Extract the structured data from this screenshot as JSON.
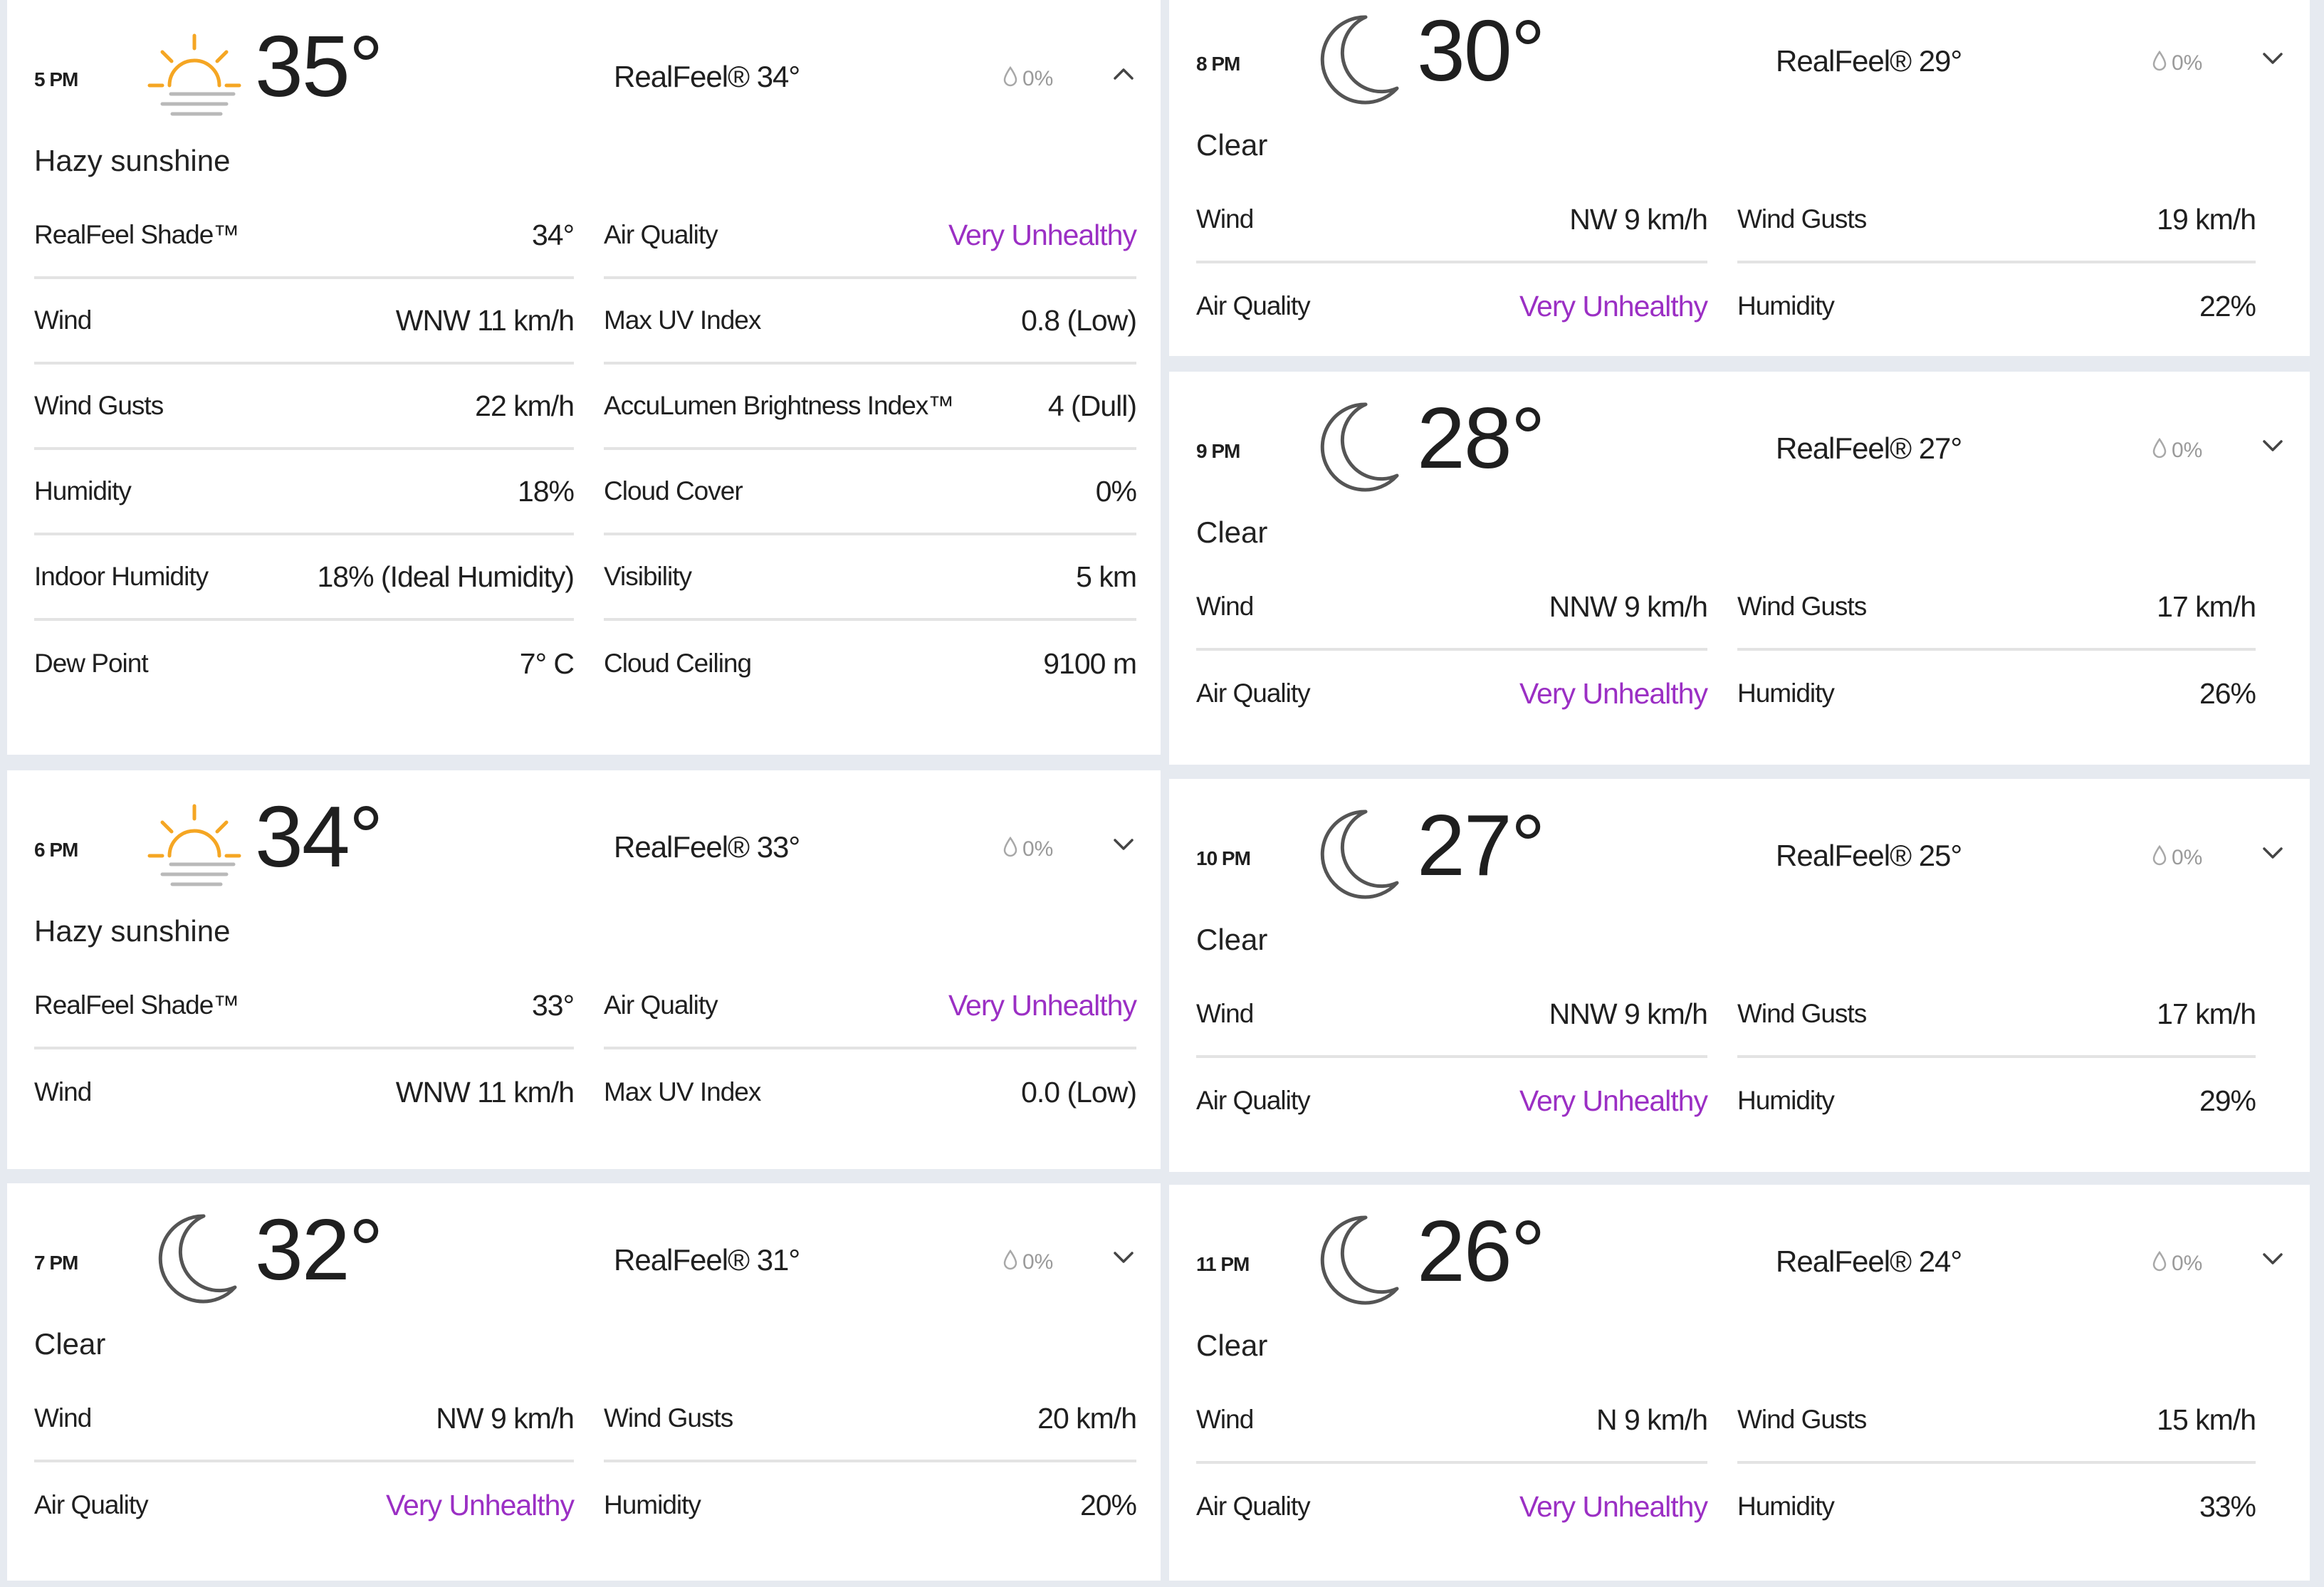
{
  "colors": {
    "air_quality": "#9b2fc4",
    "sun": "#f5a623",
    "text": "#1f1f1f",
    "muted": "#9a9a9a",
    "background": "#e6eaf0"
  },
  "hours": [
    {
      "time": "5 PM",
      "temp": "35°",
      "icon": "hazy-sun-icon",
      "realfeel": "RealFeel® 34°",
      "precip": "0%",
      "expanded": true,
      "phrase": "Hazy sunshine",
      "left": [
        {
          "label": "RealFeel Shade™",
          "value": "34°"
        },
        {
          "label": "Wind",
          "value": "WNW 11 km/h"
        },
        {
          "label": "Wind Gusts",
          "value": "22 km/h"
        },
        {
          "label": "Humidity",
          "value": "18%"
        },
        {
          "label": "Indoor Humidity",
          "value": "18% (Ideal Humidity)"
        },
        {
          "label": "Dew Point",
          "value": "7° C"
        }
      ],
      "right": [
        {
          "label": "Air Quality",
          "value": "Very Unhealthy"
        },
        {
          "label": "Max UV Index",
          "value": "0.8 (Low)"
        },
        {
          "label": "AccuLumen Brightness Index™",
          "value": "4 (Dull)"
        },
        {
          "label": "Cloud Cover",
          "value": "0%"
        },
        {
          "label": "Visibility",
          "value": "5 km"
        },
        {
          "label": "Cloud Ceiling",
          "value": "9100 m"
        }
      ]
    },
    {
      "time": "6 PM",
      "temp": "34°",
      "icon": "hazy-sun-icon",
      "realfeel": "RealFeel® 33°",
      "precip": "0%",
      "expanded": false,
      "phrase": "Hazy sunshine",
      "left": [
        {
          "label": "RealFeel Shade™",
          "value": "33°"
        },
        {
          "label": "Wind",
          "value": "WNW 11 km/h"
        }
      ],
      "right": [
        {
          "label": "Air Quality",
          "value": "Very Unhealthy"
        },
        {
          "label": "Max UV Index",
          "value": "0.0 (Low)"
        }
      ]
    },
    {
      "time": "7 PM",
      "temp": "32°",
      "icon": "moon-icon",
      "realfeel": "RealFeel® 31°",
      "precip": "0%",
      "expanded": false,
      "phrase": "Clear",
      "left": [
        {
          "label": "Wind",
          "value": "NW 9 km/h"
        },
        {
          "label": "Air Quality",
          "value": "Very Unhealthy"
        }
      ],
      "right": [
        {
          "label": "Wind Gusts",
          "value": "20 km/h"
        },
        {
          "label": "Humidity",
          "value": "20%"
        }
      ]
    },
    {
      "time": "8 PM",
      "temp": "30°",
      "icon": "moon-icon",
      "realfeel": "RealFeel® 29°",
      "precip": "0%",
      "expanded": false,
      "phrase": "Clear",
      "left": [
        {
          "label": "Wind",
          "value": "NW 9 km/h"
        },
        {
          "label": "Air Quality",
          "value": "Very Unhealthy"
        }
      ],
      "right": [
        {
          "label": "Wind Gusts",
          "value": "19 km/h"
        },
        {
          "label": "Humidity",
          "value": "22%"
        }
      ]
    },
    {
      "time": "9 PM",
      "temp": "28°",
      "icon": "moon-icon",
      "realfeel": "RealFeel® 27°",
      "precip": "0%",
      "expanded": false,
      "phrase": "Clear",
      "left": [
        {
          "label": "Wind",
          "value": "NNW 9 km/h"
        },
        {
          "label": "Air Quality",
          "value": "Very Unhealthy"
        }
      ],
      "right": [
        {
          "label": "Wind Gusts",
          "value": "17 km/h"
        },
        {
          "label": "Humidity",
          "value": "26%"
        }
      ]
    },
    {
      "time": "10 PM",
      "temp": "27°",
      "icon": "moon-icon",
      "realfeel": "RealFeel® 25°",
      "precip": "0%",
      "expanded": false,
      "phrase": "Clear",
      "left": [
        {
          "label": "Wind",
          "value": "NNW 9 km/h"
        },
        {
          "label": "Air Quality",
          "value": "Very Unhealthy"
        }
      ],
      "right": [
        {
          "label": "Wind Gusts",
          "value": "17 km/h"
        },
        {
          "label": "Humidity",
          "value": "29%"
        }
      ]
    },
    {
      "time": "11 PM",
      "temp": "26°",
      "icon": "moon-icon",
      "realfeel": "RealFeel® 24°",
      "precip": "0%",
      "expanded": false,
      "phrase": "Clear",
      "left": [
        {
          "label": "Wind",
          "value": "N 9 km/h"
        },
        {
          "label": "Air Quality",
          "value": "Very Unhealthy"
        }
      ],
      "right": [
        {
          "label": "Wind Gusts",
          "value": "15 km/h"
        },
        {
          "label": "Humidity",
          "value": "33%"
        }
      ]
    }
  ]
}
